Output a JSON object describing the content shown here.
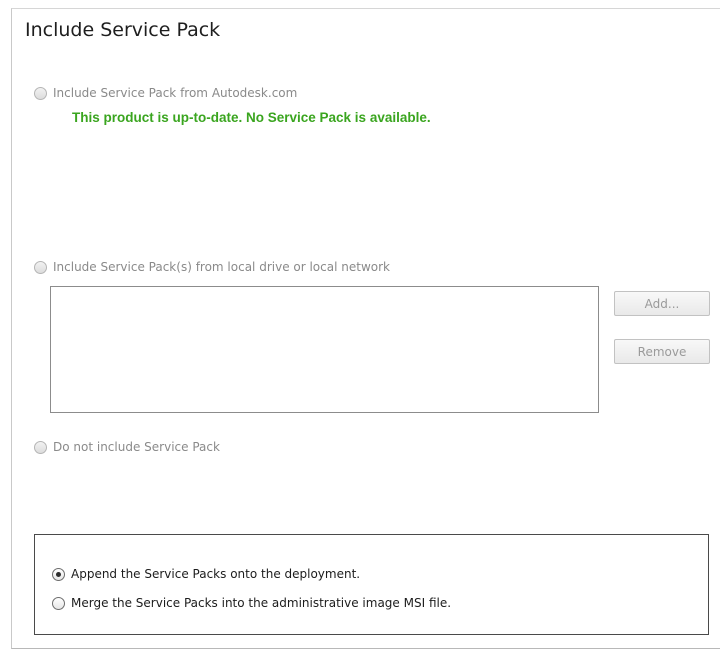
{
  "page": {
    "title": "Include Service Pack"
  },
  "options": {
    "from_autodesk": {
      "label": "Include Service Pack from Autodesk.com",
      "checked": false,
      "enabled": false
    },
    "status_message": "This product is up-to-date. No Service Pack is available.",
    "from_local": {
      "label": "Include Service Pack(s) from local drive or local network",
      "checked": false,
      "enabled": false
    },
    "do_not_include": {
      "label": "Do not include Service Pack",
      "checked": false,
      "enabled": false
    }
  },
  "buttons": {
    "add_label": "Add...",
    "remove_label": "Remove"
  },
  "deployment": {
    "append": {
      "label": "Append the Service Packs onto the deployment.",
      "checked": true
    },
    "merge": {
      "label": "Merge the Service Packs into the administrative image MSI file.",
      "checked": false
    }
  },
  "colors": {
    "status_green": "#3aa51f",
    "disabled_text": "#8a8a8a"
  }
}
